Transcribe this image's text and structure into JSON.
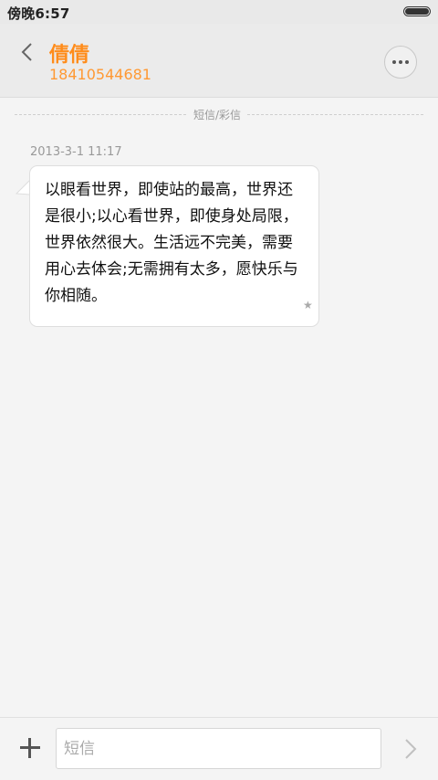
{
  "status_bar": {
    "time": "傍晚6:57",
    "battery_level": 1.0
  },
  "header": {
    "back_icon": "chevron-left-icon",
    "contact_name": "倩倩",
    "contact_number": "18410544681",
    "more_icon": "ellipsis-icon",
    "accent_color": "#ff8c1a"
  },
  "conversation": {
    "divider_label": "短信/彩信",
    "messages": [
      {
        "timestamp": "2013-3-1 11:17",
        "text": "以眼看世界，即使站的最高，世界还是很小;以心看世界，即使身处局限，世界依然很大。生活远不完美，需要用心去体会;无需拥有太多，愿快乐与你相随。",
        "starred_icon": "star-icon",
        "star_glyph": "★"
      }
    ]
  },
  "composer": {
    "add_icon": "plus-icon",
    "input_value": "",
    "input_placeholder": "短信",
    "send_icon": "chevron-right-icon"
  }
}
